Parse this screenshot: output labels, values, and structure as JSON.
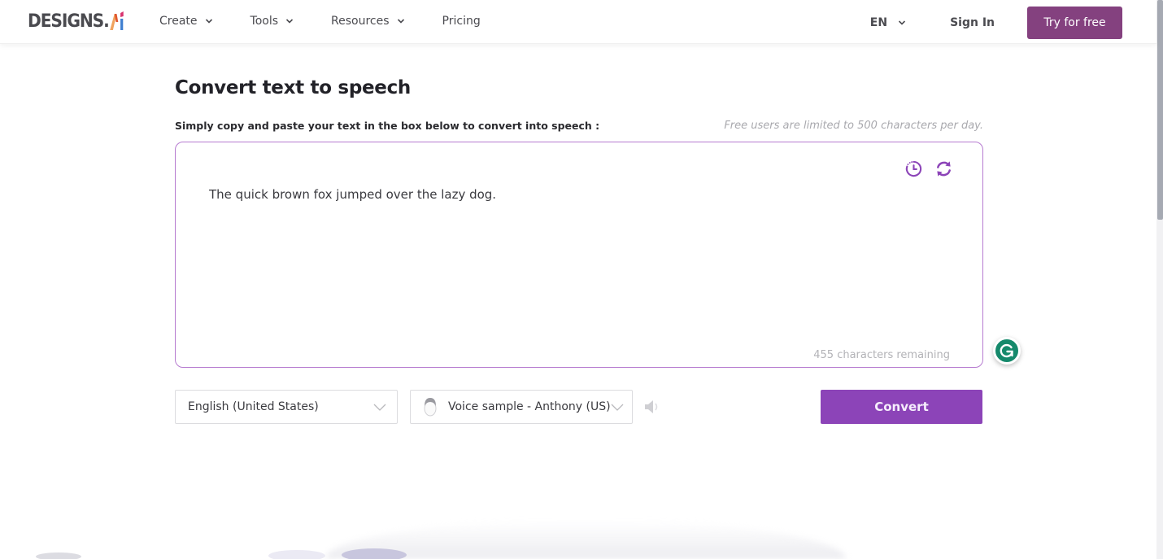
{
  "header": {
    "logo": {
      "main": "DESIGNS.",
      "ai_letters": [
        "A",
        "I"
      ]
    },
    "nav": [
      {
        "label": "Create",
        "has_dropdown": true
      },
      {
        "label": "Tools",
        "has_dropdown": true
      },
      {
        "label": "Resources",
        "has_dropdown": true
      },
      {
        "label": "Pricing",
        "has_dropdown": false
      }
    ],
    "language": "EN",
    "sign_in": "Sign In",
    "try_free": "Try for free"
  },
  "main": {
    "title": "Convert text to speech",
    "instructions": "Simply copy and paste your text in the box below to convert into speech :",
    "limit_note": "Free users are limited to 500 characters per day.",
    "textbox": {
      "value": "The quick brown fox jumped over the lazy dog.",
      "remaining": "455 characters remaining",
      "icons": [
        "history-icon",
        "refresh-icon"
      ]
    },
    "language_select": {
      "selected": "English (United States)"
    },
    "voice_select": {
      "selected": "Voice sample - Anthony (US)"
    },
    "convert_label": "Convert"
  },
  "colors": {
    "brand_purple": "#84417f",
    "accent_purple": "#8c44b8",
    "textbox_border": "#b67bd0",
    "grammarly_green": "#15896b"
  }
}
